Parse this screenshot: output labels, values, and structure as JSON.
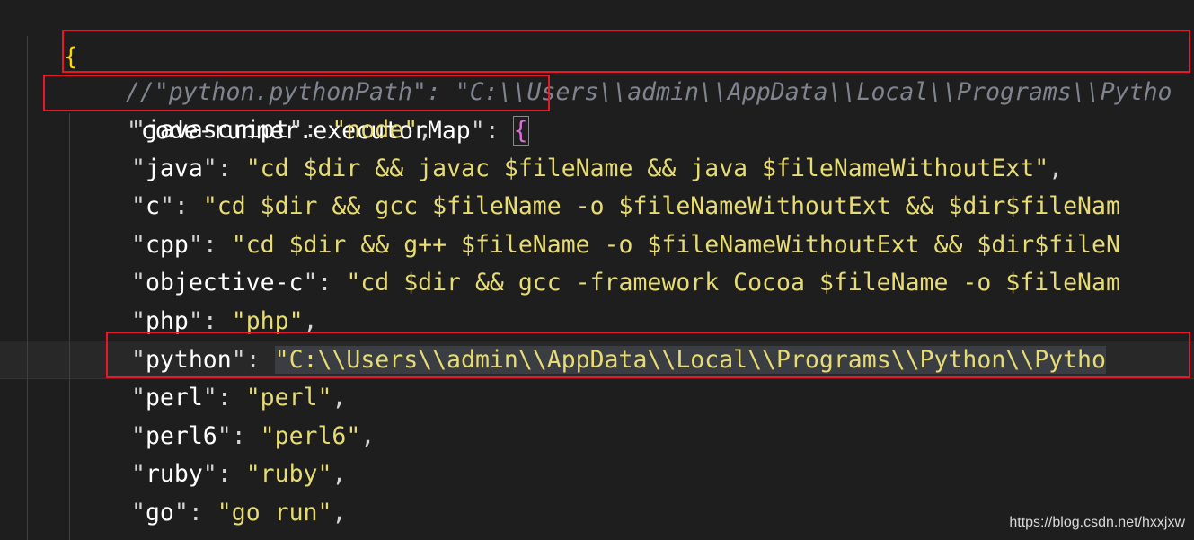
{
  "editor": {
    "open_brace": "{",
    "comment_line": "//\"python.pythonPath\": \"C:\\\\Users\\\\admin\\\\AppData\\\\Local\\\\Programs\\\\Pytho",
    "executor_key": "code-runner.executorMap",
    "executor_brace": "{",
    "entries": [
      {
        "key": "javascript",
        "value": "node",
        "trail": ","
      },
      {
        "key": "java",
        "value": "cd $dir && javac $fileName && java $fileNameWithoutExt",
        "trail": ","
      },
      {
        "key": "c",
        "value": "cd $dir && gcc $fileName -o $fileNameWithoutExt && $dir$fileNam",
        "trail": ""
      },
      {
        "key": "cpp",
        "value": "cd $dir && g++ $fileName -o $fileNameWithoutExt && $dir$fileN",
        "trail": ""
      },
      {
        "key": "objective-c",
        "value": "cd $dir && gcc -framework Cocoa $fileName -o $fileNam",
        "trail": ""
      },
      {
        "key": "php",
        "value": "php",
        "trail": ","
      },
      {
        "key": "python",
        "value": "C:\\\\Users\\\\admin\\\\AppData\\\\Local\\\\Programs\\\\Python\\\\Pytho",
        "trail": ""
      },
      {
        "key": "perl",
        "value": "perl",
        "trail": ","
      },
      {
        "key": "perl6",
        "value": "perl6",
        "trail": ","
      },
      {
        "key": "ruby",
        "value": "ruby",
        "trail": ","
      },
      {
        "key": "go",
        "value": "go run",
        "trail": ","
      }
    ]
  },
  "watermark": "https://blog.csdn.net/hxxjxw",
  "colors": {
    "background": "#1e1e1e",
    "highlight_box": "#e8172a",
    "string": "#e6db74",
    "comment": "#7f848e"
  }
}
